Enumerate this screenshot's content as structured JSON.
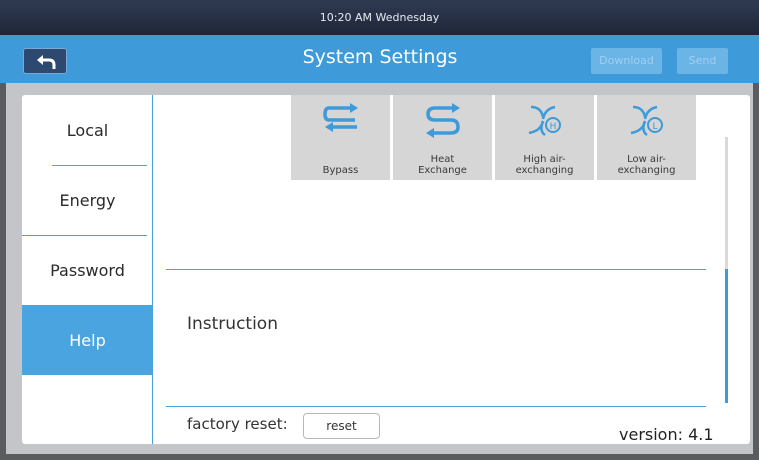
{
  "status_bar": {
    "time": "10:20 AM",
    "day": "Wednesday"
  },
  "header": {
    "title": "System Settings",
    "download_label": "Download",
    "send_label": "Send",
    "back_icon": "back-arrow-icon"
  },
  "sidebar": {
    "items": [
      {
        "label": "Local",
        "selected": false
      },
      {
        "label": "Energy",
        "selected": false
      },
      {
        "label": "Password",
        "selected": false
      },
      {
        "label": "Help",
        "selected": true
      }
    ]
  },
  "modes": [
    {
      "line1": "Bypass",
      "line2": "",
      "icon": "bypass-icon"
    },
    {
      "line1": "Heat",
      "line2": "Exchange",
      "icon": "heat-exchange-icon"
    },
    {
      "line1": "High air-",
      "line2": "exchanging",
      "icon": "high-air-exchanging-icon"
    },
    {
      "line1": "Low air-",
      "line2": "exchanging",
      "icon": "low-air-exchanging-icon"
    }
  ],
  "help": {
    "instruction_label": "Instruction",
    "factory_reset_label": "factory reset:",
    "reset_button_label": "reset",
    "version_text": "version:  4.1"
  },
  "colors": {
    "accent": "#3e9ad8",
    "selected_nav": "#4aa4e0",
    "status_bar": "#1f2638"
  }
}
